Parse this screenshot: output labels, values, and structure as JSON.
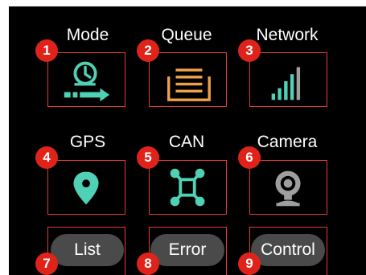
{
  "tiles": [
    {
      "label": "Mode",
      "badge": "1",
      "icon": "schedule-arrow-icon"
    },
    {
      "label": "Queue",
      "badge": "2",
      "icon": "queue-tray-icon"
    },
    {
      "label": "Network",
      "badge": "3",
      "icon": "signal-bars-icon"
    },
    {
      "label": "GPS",
      "badge": "4",
      "icon": "location-pin-icon"
    },
    {
      "label": "CAN",
      "badge": "5",
      "icon": "can-bus-icon"
    },
    {
      "label": "Camera",
      "badge": "6",
      "icon": "webcam-icon"
    }
  ],
  "buttons": [
    {
      "label": "List",
      "badge": "7"
    },
    {
      "label": "Error",
      "badge": "8"
    },
    {
      "label": "Control",
      "badge": "9"
    }
  ],
  "colors": {
    "background": "#000000",
    "accent": "#4fd1b5",
    "queue": "#f0a04b",
    "badge": "#e0231a",
    "outline": "#e53935",
    "pill": "#4a4a4a",
    "camera": "#9e9e9e"
  }
}
